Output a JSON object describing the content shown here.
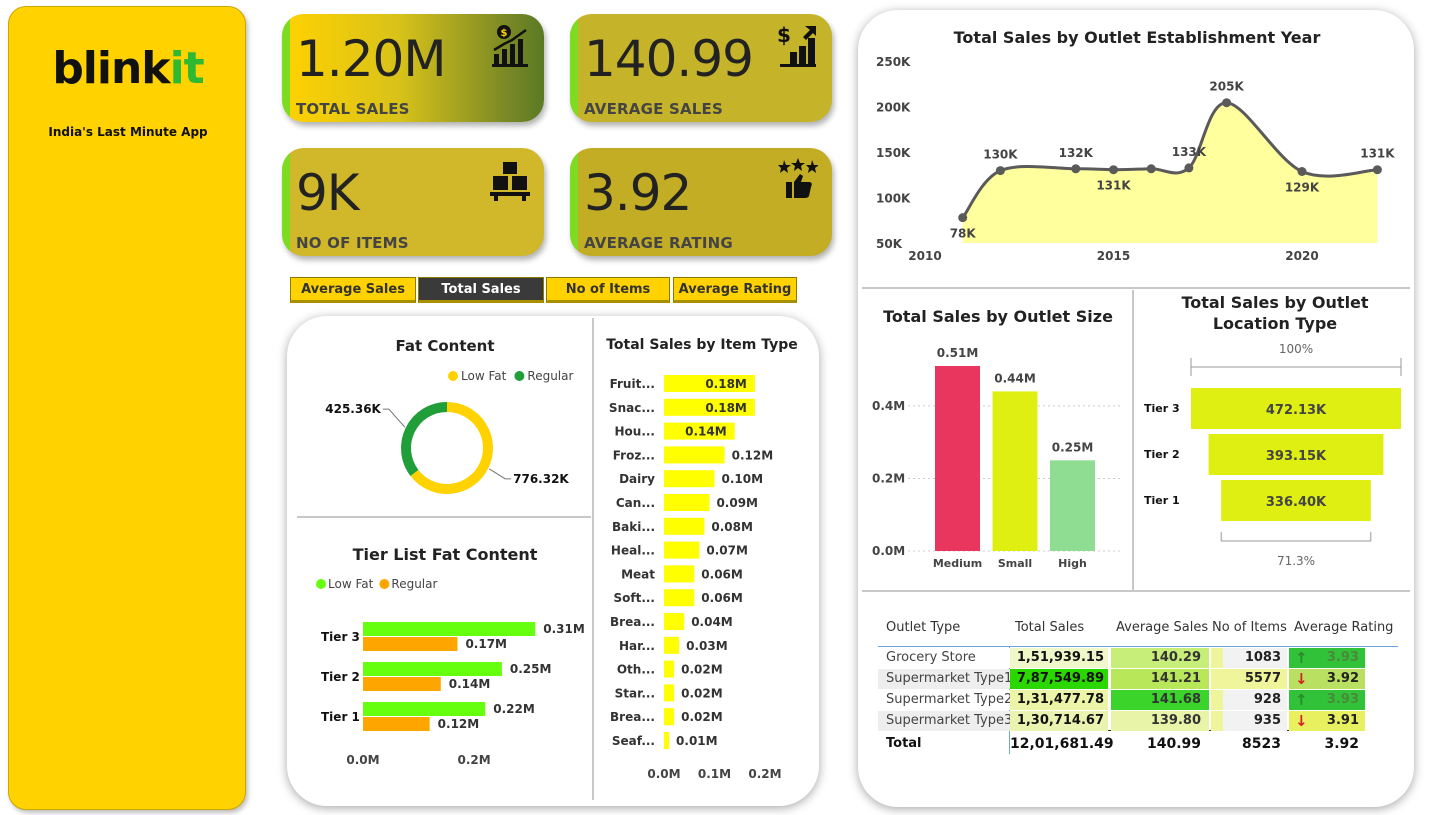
{
  "brand": {
    "logo_main": "blink",
    "logo_accent": "it",
    "tagline": "India's Last Minute App"
  },
  "kpis": [
    {
      "value": "1.20M",
      "label": "TOTAL SALES",
      "icon": "sales-chart-icon"
    },
    {
      "value": "140.99",
      "label": "AVERAGE SALES",
      "icon": "dollar-growth-icon"
    },
    {
      "value": "9K",
      "label": "NO OF ITEMS",
      "icon": "boxes-icon"
    },
    {
      "value": "3.92",
      "label": "AVERAGE RATING",
      "icon": "thumbs-up-stars-icon"
    }
  ],
  "tabs": [
    {
      "label": "Average Sales",
      "active": false
    },
    {
      "label": "Total Sales",
      "active": true
    },
    {
      "label": "No of Items",
      "active": false
    },
    {
      "label": "Average Rating",
      "active": false
    }
  ],
  "colors": {
    "brand_yellow": "#ffd200",
    "accent_green": "#7ddc1f",
    "line": "#5a5a5a",
    "area_fill": "#ffff9e"
  },
  "chart_data": [
    {
      "id": "fat_content",
      "type": "pie",
      "title": "Fat Content",
      "legend": [
        "Low Fat",
        "Regular"
      ],
      "legend_position": "top-right",
      "categories": [
        "Low Fat",
        "Regular"
      ],
      "values": [
        776.32,
        425.36
      ],
      "labels": [
        "776.32K",
        "425.36K"
      ],
      "colors": [
        "#ffd200",
        "#1f9e3a"
      ]
    },
    {
      "id": "tier_fat",
      "type": "bar",
      "title": "Tier List Fat Content",
      "legend": [
        "Low Fat",
        "Regular"
      ],
      "categories": [
        "Tier 3",
        "Tier 2",
        "Tier 1"
      ],
      "series": [
        {
          "name": "Low Fat",
          "values": [
            0.31,
            0.25,
            0.22
          ],
          "labels": [
            "0.31M",
            "0.25M",
            "0.22M"
          ],
          "color": "#66ff10"
        },
        {
          "name": "Regular",
          "values": [
            0.17,
            0.14,
            0.12
          ],
          "labels": [
            "0.17M",
            "0.14M",
            "0.12M"
          ],
          "color": "#ffa500"
        }
      ],
      "xticks": [
        "0.0M",
        "0.2M"
      ],
      "xlim": [
        0,
        0.36
      ]
    },
    {
      "id": "item_type",
      "type": "bar",
      "title": "Total Sales by Item Type",
      "categories": [
        "Fruit...",
        "Snac...",
        "Hou...",
        "Froz...",
        "Dairy",
        "Can...",
        "Baki...",
        "Heal...",
        "Meat",
        "Soft...",
        "Brea...",
        "Har...",
        "Oth...",
        "Star...",
        "Brea...",
        "Seaf..."
      ],
      "values": [
        0.18,
        0.18,
        0.14,
        0.12,
        0.1,
        0.09,
        0.08,
        0.07,
        0.06,
        0.06,
        0.04,
        0.03,
        0.02,
        0.02,
        0.02,
        0.01
      ],
      "labels": [
        "0.18M",
        "0.18M",
        "0.14M",
        "0.12M",
        "0.10M",
        "0.09M",
        "0.08M",
        "0.07M",
        "0.06M",
        "0.06M",
        "0.04M",
        "0.03M",
        "0.02M",
        "0.02M",
        "0.02M",
        "0.01M"
      ],
      "xticks": [
        "0.0M",
        "0.1M",
        "0.2M"
      ],
      "xlim": [
        0,
        0.2
      ],
      "color": "#ffff00"
    },
    {
      "id": "establishment_year",
      "type": "area",
      "title": "Total Sales by Outlet Establishment Year",
      "x": [
        2011,
        2012,
        2014,
        2015,
        2016,
        2017,
        2018,
        2020,
        2022
      ],
      "values": [
        78,
        130,
        132,
        131,
        132,
        133,
        205,
        129,
        131
      ],
      "labels": [
        "78K",
        "130K",
        "132K",
        "131K",
        "",
        "133K",
        "205K",
        "129K",
        "131K"
      ],
      "yticks": [
        "250K",
        "200K",
        "150K",
        "100K",
        "50K"
      ],
      "xticks": [
        "2010",
        "2015",
        "2020"
      ],
      "ylim": [
        50,
        250
      ],
      "xlim": [
        2010,
        2022
      ]
    },
    {
      "id": "outlet_size",
      "type": "bar",
      "title": "Total Sales by Outlet Size",
      "categories": [
        "Medium",
        "Small",
        "High"
      ],
      "values": [
        0.51,
        0.44,
        0.25
      ],
      "labels": [
        "0.51M",
        "0.44M",
        "0.25M"
      ],
      "colors": [
        "#e8365e",
        "#dfef12",
        "#8edd92"
      ],
      "yticks": [
        "0.4M",
        "0.2M",
        "0.0M"
      ],
      "ylim": [
        0,
        0.51
      ]
    },
    {
      "id": "location_type",
      "type": "bar",
      "title": "Total Sales by Outlet Location Type",
      "categories": [
        "Tier 3",
        "Tier 2",
        "Tier 1"
      ],
      "values": [
        472.13,
        393.15,
        336.4
      ],
      "labels": [
        "472.13K",
        "393.15K",
        "336.40K"
      ],
      "top_label": "100%",
      "bottom_label": "71.3%",
      "color": "#dfef12"
    }
  ],
  "outlet_table": {
    "headers": [
      "Outlet Type",
      "Total Sales",
      "Average Sales",
      "No of Items",
      "Average Rating"
    ],
    "rows": [
      {
        "type": "Grocery Store",
        "total": "1,51,939.15",
        "avg": "140.29",
        "items": "1083",
        "items_pct": 0.13,
        "rating": "3.93",
        "trend": "up"
      },
      {
        "type": "Supermarket Type1",
        "total": "7,87,549.89",
        "avg": "141.21",
        "items": "5577",
        "items_pct": 1.0,
        "rating": "3.92",
        "trend": "down"
      },
      {
        "type": "Supermarket Type2",
        "total": "1,31,477.78",
        "avg": "141.68",
        "items": "928",
        "items_pct": 0.11,
        "rating": "3.93",
        "trend": "up"
      },
      {
        "type": "Supermarket Type3",
        "total": "1,30,714.67",
        "avg": "139.80",
        "items": "935",
        "items_pct": 0.11,
        "rating": "3.91",
        "trend": "down"
      }
    ],
    "total": {
      "label": "Total",
      "total": "12,01,681.49",
      "avg": "140.99",
      "items": "8523",
      "rating": "3.92"
    }
  }
}
